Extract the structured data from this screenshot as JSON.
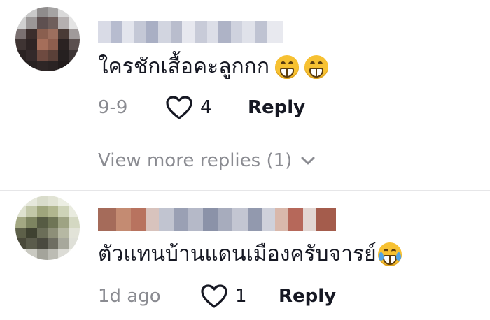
{
  "comments": [
    {
      "text": "ใครชักเสื้อคะลูกกก",
      "emojis": [
        "grinning-face-icon",
        "grinning-face-icon"
      ],
      "date": "9-9",
      "likes": "4",
      "reply_label": "Reply"
    },
    {
      "text": "ตัวแทนบ้านแดนเมืองครับจารย์",
      "emojis": [
        "tears-of-joy-icon"
      ],
      "date": "1d ago",
      "likes": "1",
      "reply_label": "Reply"
    }
  ],
  "view_more": {
    "label": "View more replies (1)"
  },
  "colors": {
    "text": "#161823",
    "muted": "#8a8b91",
    "emoji": "#f7c132"
  }
}
